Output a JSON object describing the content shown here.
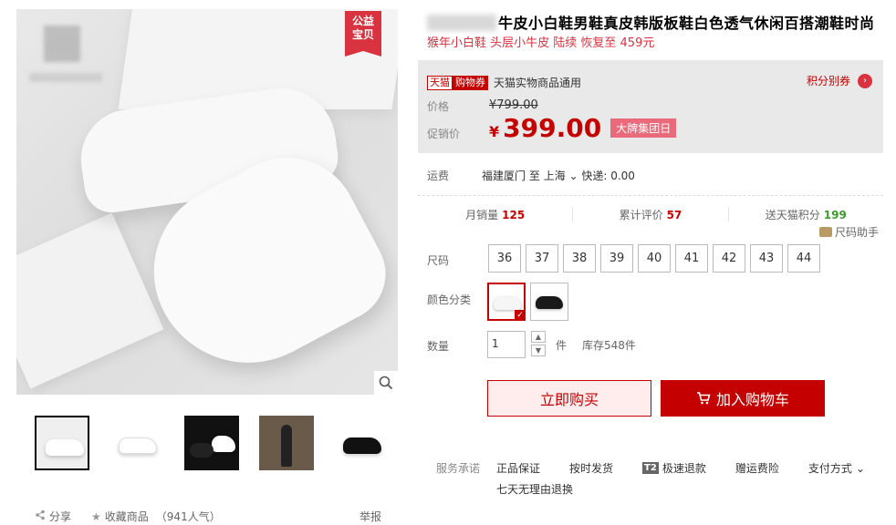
{
  "gallery": {
    "badge_line1": "公益",
    "badge_line2": "宝贝",
    "thumbnails": [
      "thumb-1",
      "thumb-2",
      "thumb-3",
      "thumb-4",
      "thumb-5"
    ]
  },
  "actions": {
    "share": "分享",
    "favorite": "收藏商品",
    "popularity": "（941人气）",
    "report": "举报"
  },
  "product": {
    "title": "牛皮小白鞋男鞋真皮韩版板鞋白色透气休闲百搭潮鞋时尚",
    "subtitle": "猴年小白鞋 头层小牛皮 陆续 恢复至 459元"
  },
  "price": {
    "tag_a": "天猫",
    "tag_b": "购物券",
    "tag_desc": "天猫实物商品通用",
    "points_link": "积分别券",
    "price_label": "价格",
    "original": "¥799.00",
    "promo_label": "促销价",
    "currency": "¥",
    "promo": "399.00",
    "promo_badge": "大牌集团日"
  },
  "shipping": {
    "label": "运费",
    "value": "福建厦门  至 上海",
    "express": "快递: 0.00"
  },
  "stats": {
    "monthly_label": "月销量",
    "monthly": "125",
    "reviews_label": "累计评价",
    "reviews": "57",
    "points_label": "送天猫积分",
    "points": "199"
  },
  "size_helper": "尺码助手",
  "sizes": {
    "label": "尺码",
    "options": [
      "36",
      "37",
      "38",
      "39",
      "40",
      "41",
      "42",
      "43",
      "44"
    ]
  },
  "colors": {
    "label": "颜色分类",
    "options": [
      {
        "swatch": "#f6f6f6",
        "selected": true
      },
      {
        "swatch": "#1a1a1a",
        "selected": false
      }
    ]
  },
  "quantity": {
    "label": "数量",
    "value": "1",
    "unit": "件",
    "stock": "库存548件"
  },
  "buttons": {
    "buy_now": "立即购买",
    "add_cart": "加入购物车"
  },
  "services": {
    "label": "服务承诺",
    "items": [
      "正品保证",
      "按时发货",
      "极速退款",
      "赠运费险",
      "支付方式"
    ],
    "t2": "T2",
    "extra": "七天无理由退换"
  },
  "colors_theme": {
    "accent": "#c40000",
    "accent_light": "#ffeded",
    "points_green": "#3c9a2c"
  }
}
